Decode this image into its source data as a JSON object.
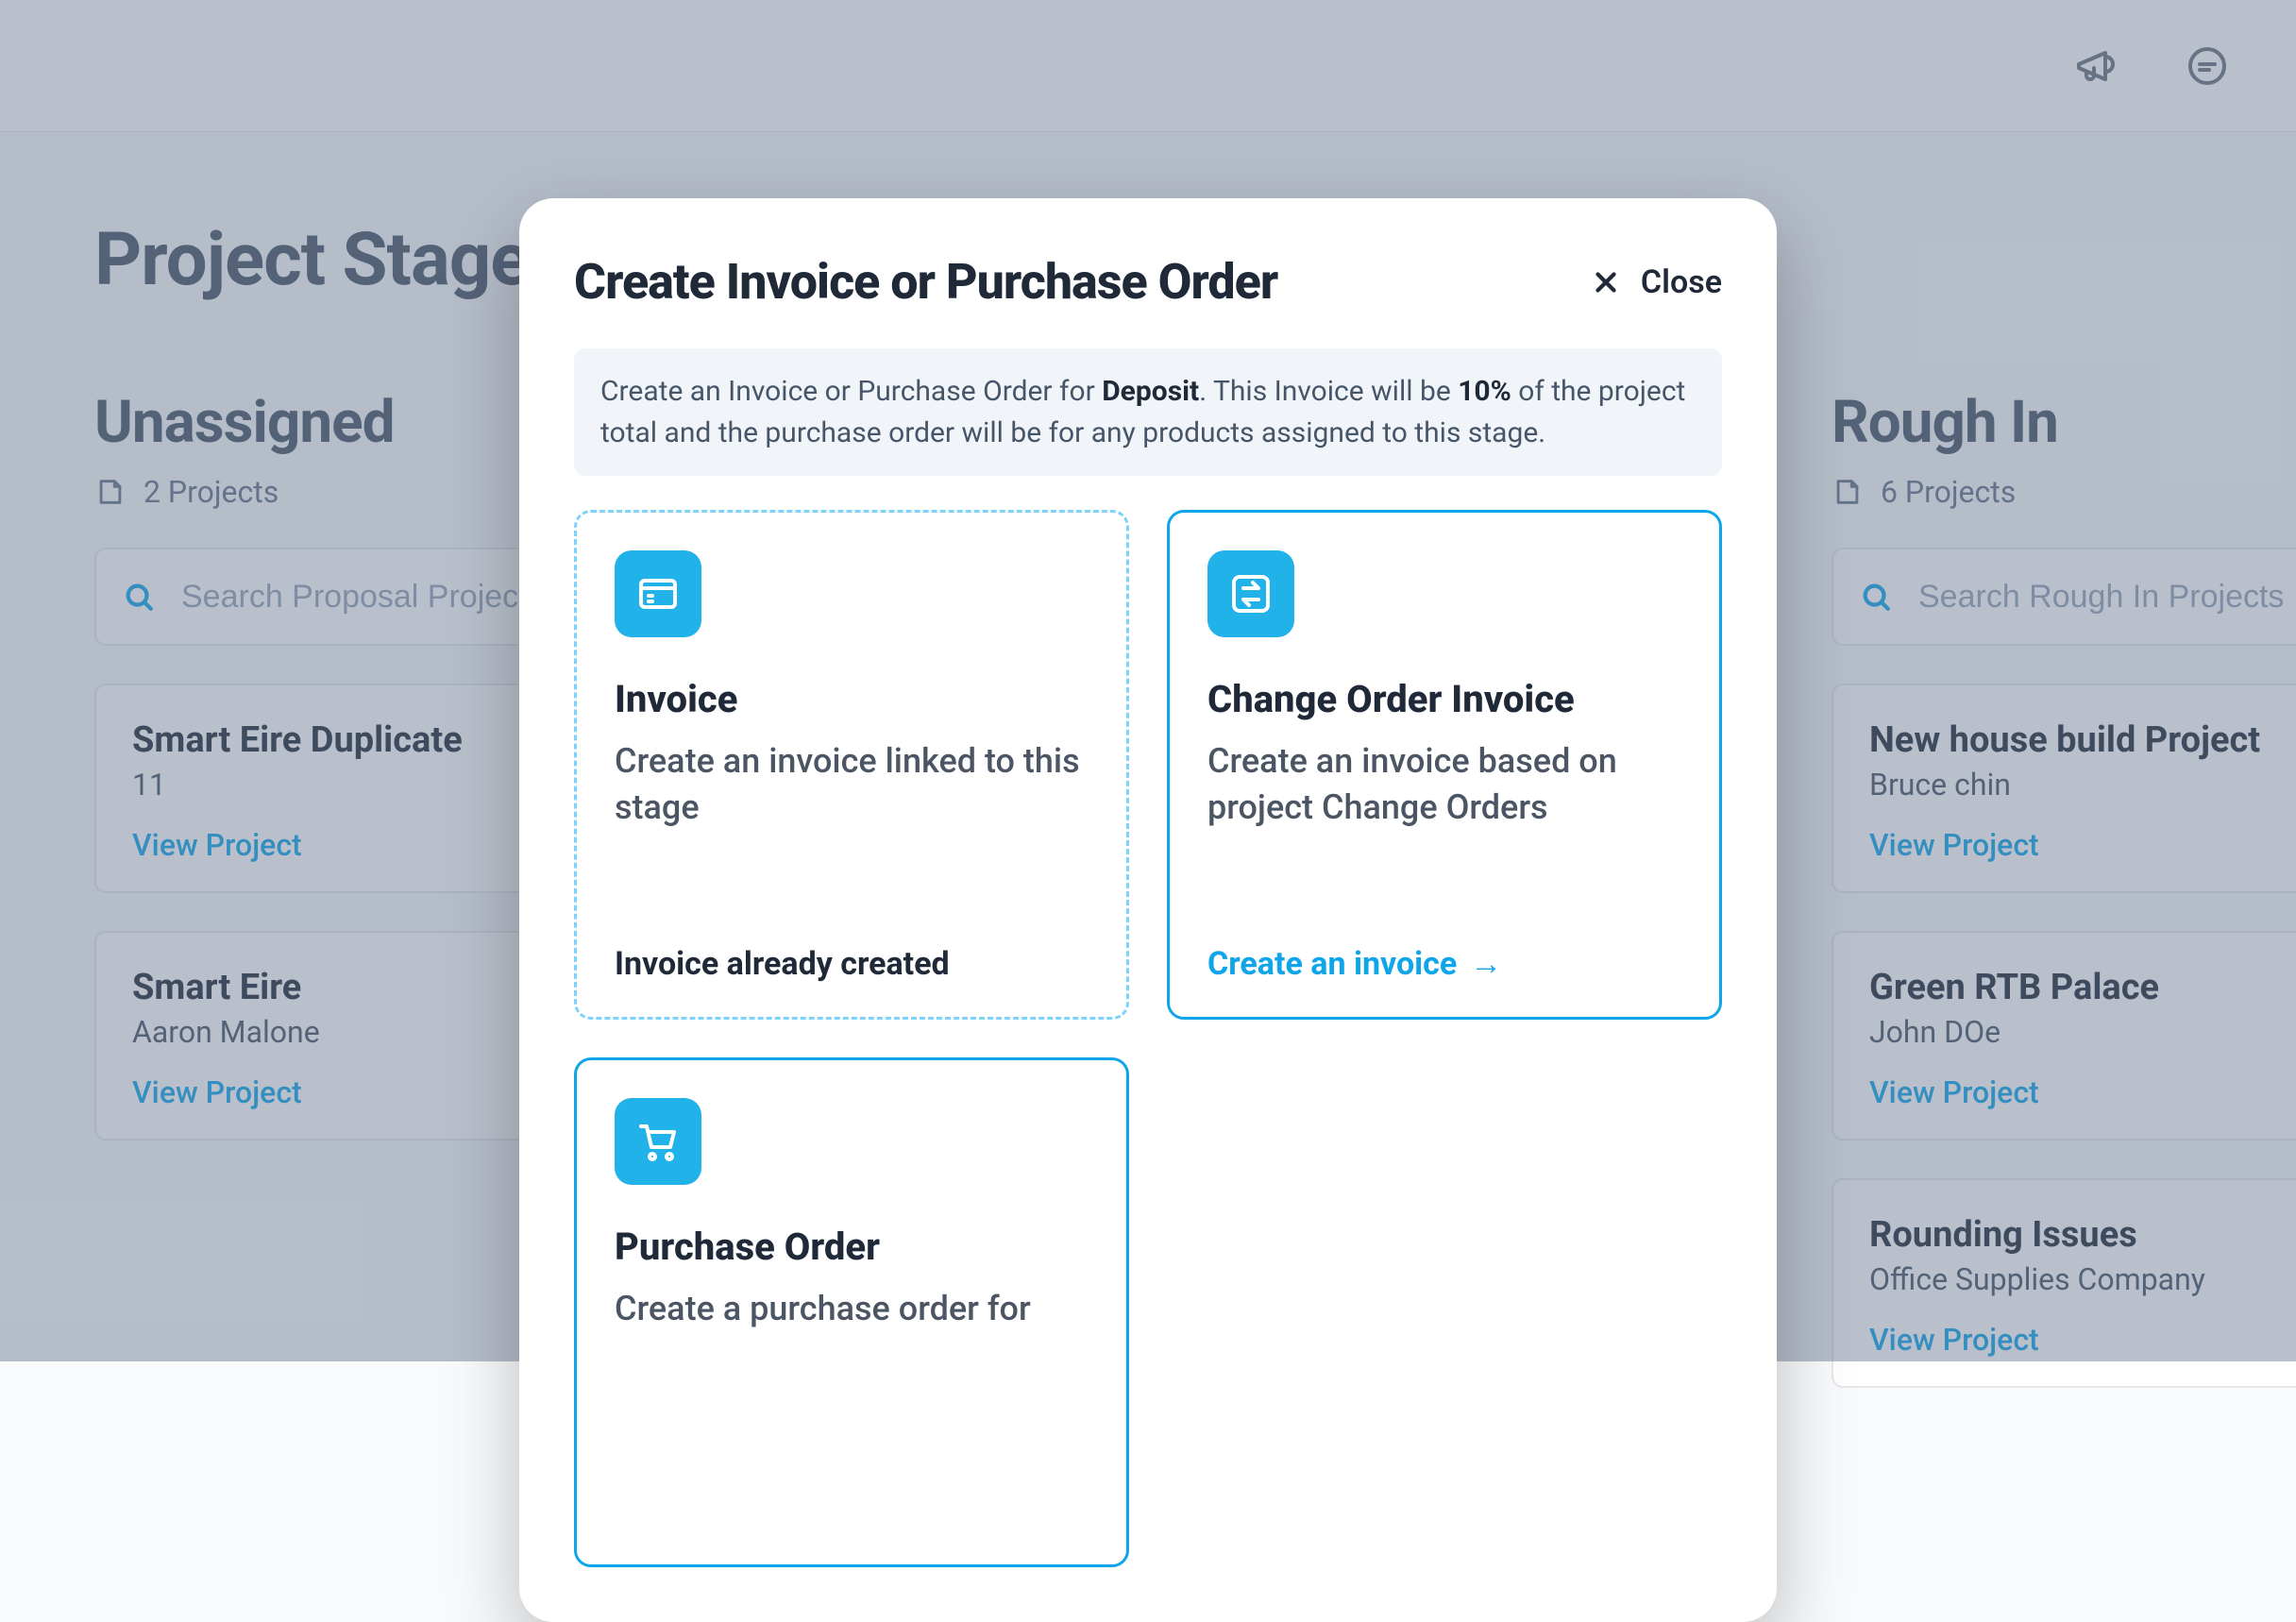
{
  "topbar": {},
  "page": {
    "title": "Project Stages"
  },
  "columns": [
    {
      "key": "unassigned",
      "title": "Unassigned",
      "countLabel": "2 Projects",
      "searchPlaceholder": "Search Proposal Projects",
      "cards": [
        {
          "title": "Smart Eire Duplicate",
          "subtitle": "11",
          "link": "View Project"
        },
        {
          "title": "Smart Eire",
          "subtitle": "Aaron Malone",
          "link": "View Project"
        }
      ]
    },
    {
      "key": "middle",
      "title": "",
      "countLabel": "",
      "searchPlaceholder": "",
      "cards": []
    },
    {
      "key": "roughin",
      "title": "Rough In",
      "countLabel": "6 Projects",
      "searchPlaceholder": "Search Rough In Projects",
      "cards": [
        {
          "title": "New house build Project",
          "subtitle": "Bruce chin",
          "link": "View Project"
        },
        {
          "title": "Green RTB Palace",
          "subtitle": "John DOe",
          "link": "View Project"
        },
        {
          "title": "Rounding Issues",
          "subtitle": "Office Supplies Company",
          "link": "View Project"
        }
      ]
    }
  ],
  "modal": {
    "title": "Create Invoice or Purchase Order",
    "closeLabel": "Close",
    "note": {
      "prefix": "Create an Invoice or Purchase Order for ",
      "boldStage": "Deposit",
      "mid": ". This Invoice will be ",
      "boldPercent": "10%",
      "suffix": " of the project total and the purchase order will be for any products assigned to this stage."
    },
    "options": [
      {
        "key": "invoice",
        "label": "Invoice",
        "desc": "Create an invoice linked to this stage",
        "footer": "Invoice already created",
        "style": "dashed"
      },
      {
        "key": "changeorder",
        "label": "Change Order Invoice",
        "desc": "Create an invoice based on project Change Orders",
        "cta": "Create an invoice",
        "style": "solid"
      },
      {
        "key": "purchaseorder",
        "label": "Purchase Order",
        "desc": "Create a purchase order for",
        "style": "solid"
      }
    ]
  }
}
